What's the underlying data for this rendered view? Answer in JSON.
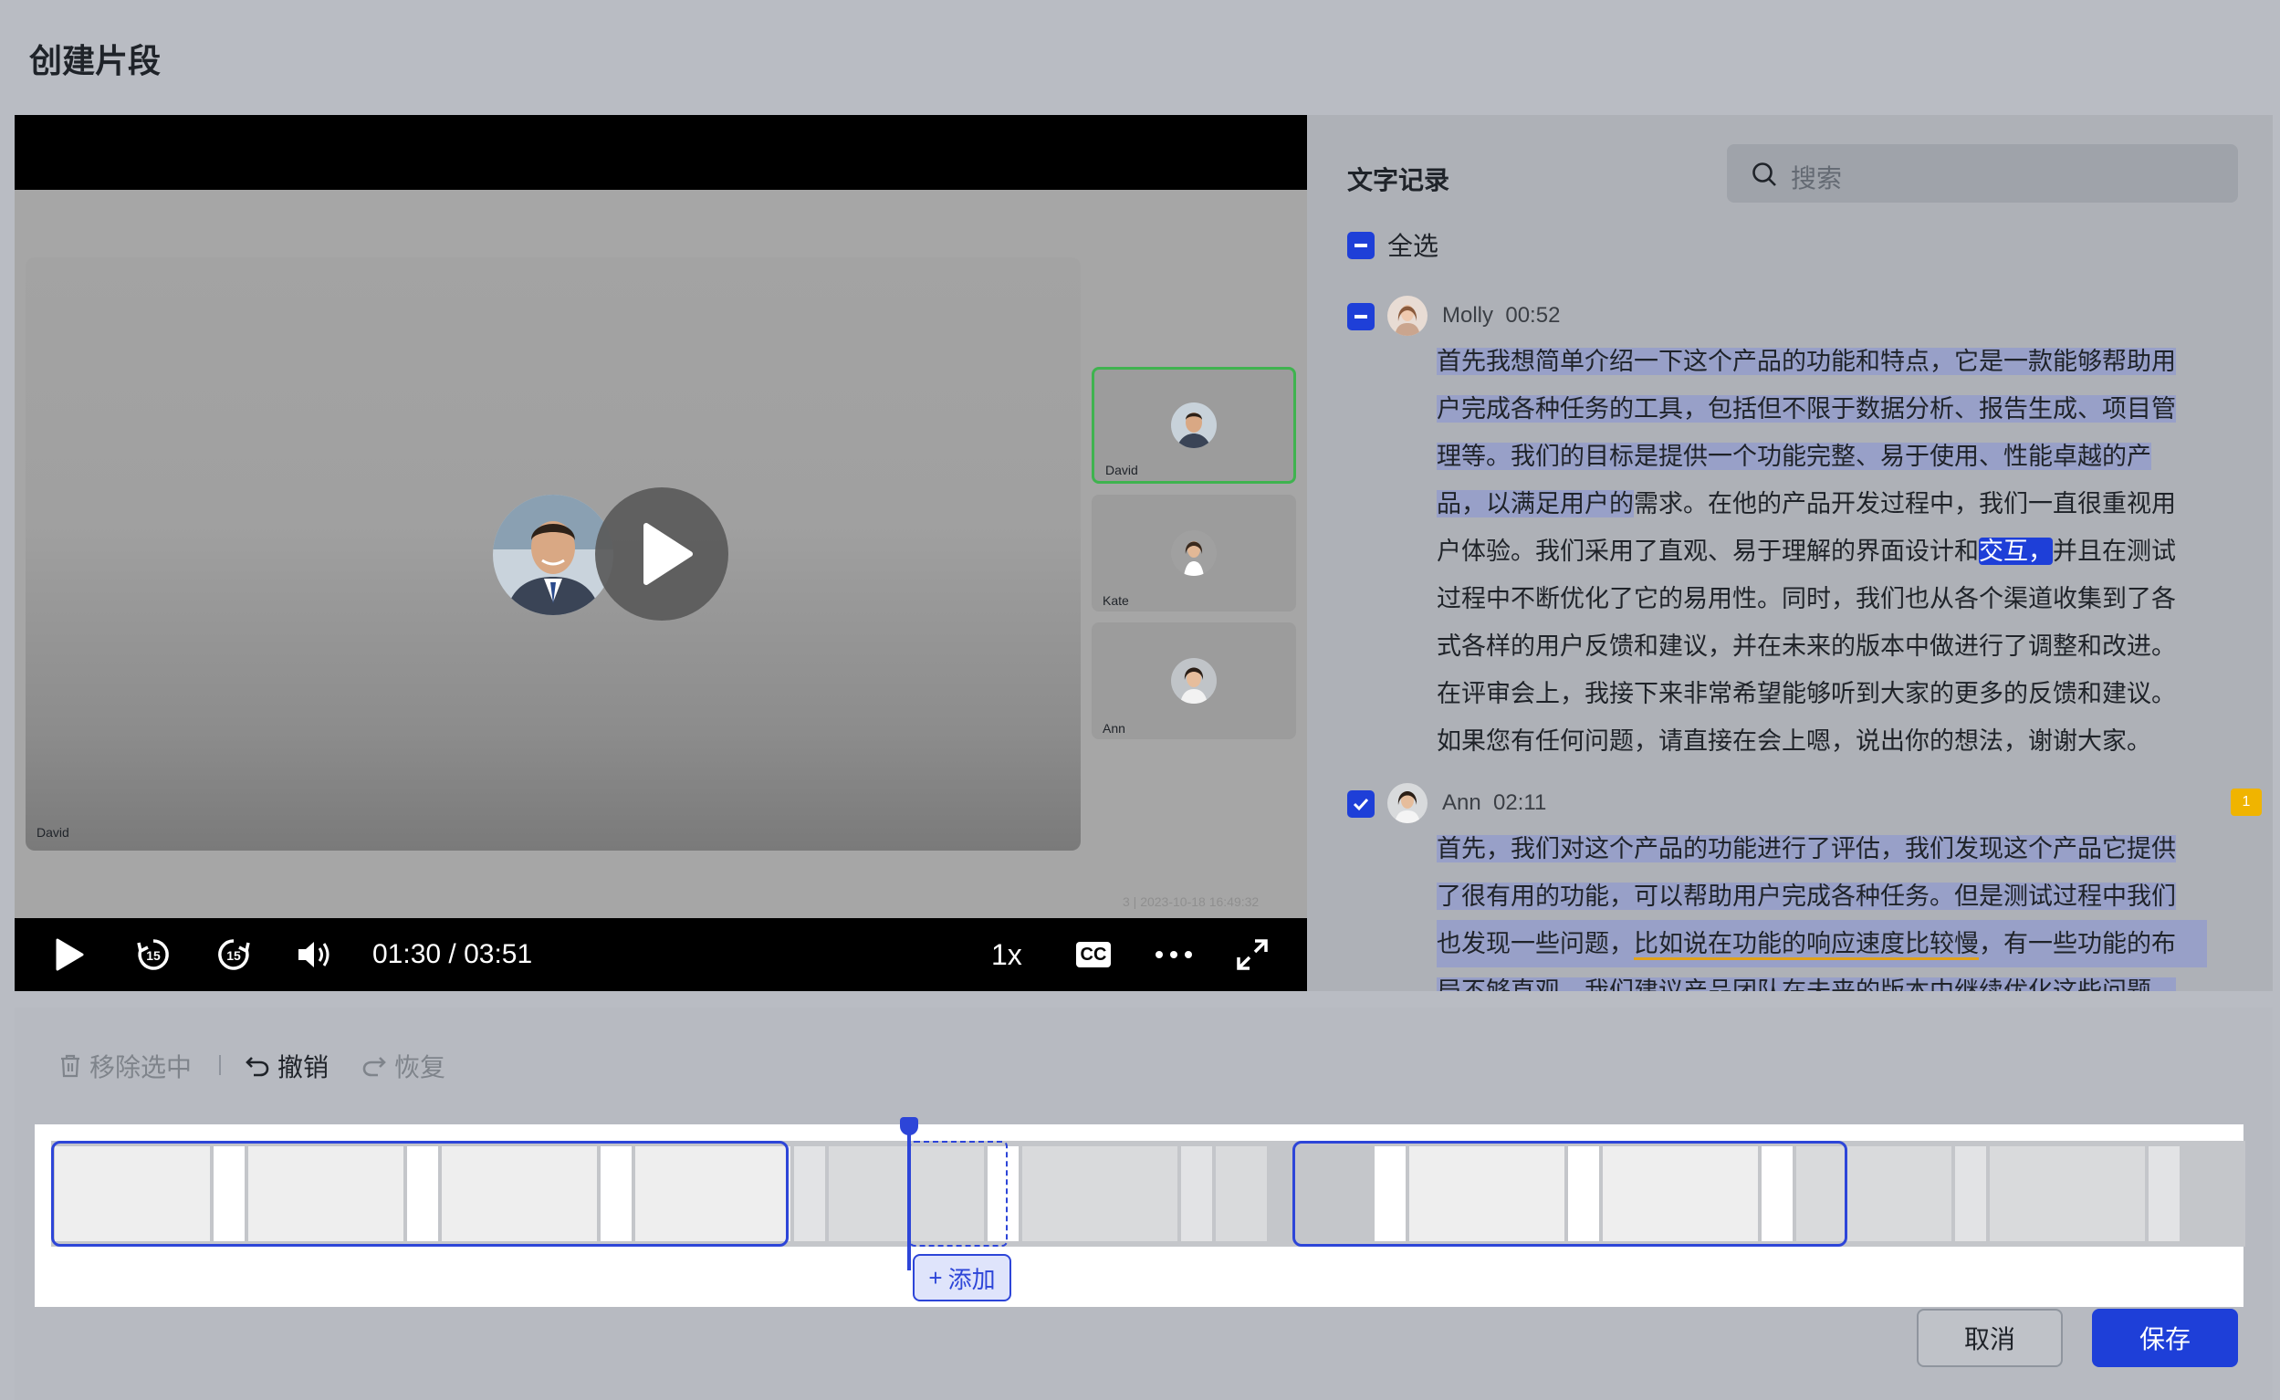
{
  "dialog": {
    "title": "创建片段"
  },
  "video": {
    "main_speaker": "David",
    "thumbnails": [
      {
        "name": "David",
        "active": true
      },
      {
        "name": "Kate",
        "active": false
      },
      {
        "name": "Ann",
        "active": false
      }
    ],
    "time": "01:30 / 03:51",
    "speed": "1x",
    "cc_label": "CC",
    "watermark": "3 | 2023-10-18 16:49:32",
    "skip_seconds": "15"
  },
  "transcript": {
    "title": "文字记录",
    "search_placeholder": "搜索",
    "select_all": "全选",
    "entries": [
      {
        "speaker": "Molly",
        "time": "00:52",
        "lines": [
          "首先我想简单介绍一下这个产品的功能和特点，它是一款能够帮助用",
          "户完成各种任务的工具，包括但不限于数据分析、报告生成、项目管",
          "理等。我们的目标是提供一个功能完整、易于使用、性能卓越的产",
          "品，以满足用户的需求。在他的产品开发过程中，我们一直很重视用",
          "户体验。我们采用了直观、易于理解的界面设计和交互，并且在测试",
          "过程中不断优化了它的易用性。同时，我们也从各个渠道收集到了各",
          "式各样的用户反馈和建议，并在未来的版本中做进行了调整和改进。",
          "在评审会上，我接下来非常希望能够听到大家的更多的反馈和建议。",
          "如果您有任何问题，请直接在会上嗯，说出你的想法，谢谢大家。"
        ],
        "line4_a": "品，以满足用户的",
        "line4_b": "需求。在他的产品开发过程中，我们一直很重视用",
        "line5_a": "户体验。我们采用了直观、易于理解的界面设计和",
        "line5_b": "交互，",
        "line5_c": "并且在测试"
      },
      {
        "speaker": "Ann",
        "time": "02:11",
        "comment_count": "1",
        "lines": [
          "首先，我们对这个产品的功能进行了评估，我们发现这个产品它提供",
          "了很有用的功能，可以帮助用户完成各种任务。但是测试过程中我们",
          "也发现一些问题，比如说在功能的响应速度比较慢，有一些功能的布",
          "局不够直观，我们建议产品团队在未来的版本中继续优化这些问题。"
        ],
        "line3_a": "也发现一些问题，",
        "line3_b": "比如说在功能的响应速度比较慢",
        "line3_c": "，有一些功能的布"
      }
    ]
  },
  "toolbar": {
    "remove_selected": "移除选中",
    "undo": "撤销",
    "redo": "恢复"
  },
  "timeline": {
    "add_label": "添加"
  },
  "footer": {
    "cancel": "取消",
    "save": "保存"
  },
  "colors": {
    "accent": "#1e3fd8",
    "active_tile": "#3fb34f",
    "comment": "#f0b400"
  }
}
